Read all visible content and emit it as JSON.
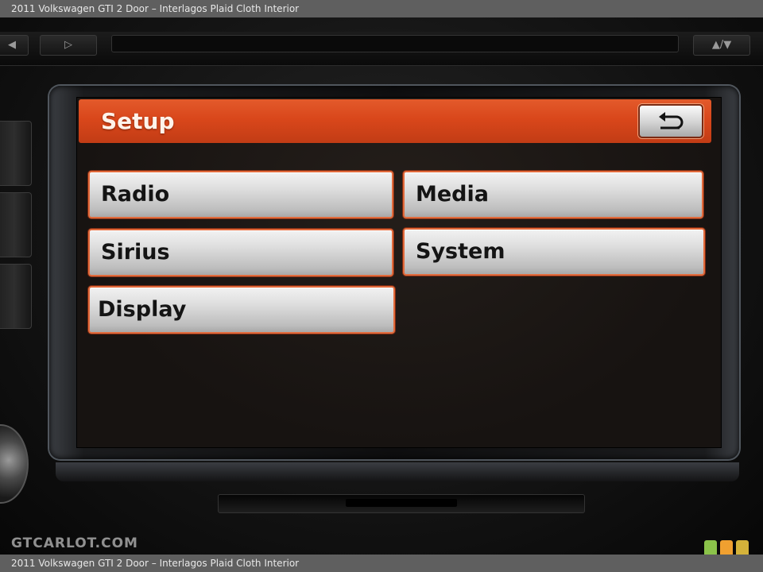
{
  "caption": {
    "top": "2011 Volkswagen GTI 2 Door – Interlagos Plaid Cloth Interior",
    "bottom": "2011 Volkswagen GTI 2 Door – Interlagos Plaid Cloth Interior"
  },
  "hardware": {
    "top_key_label": "▲/▼"
  },
  "screen": {
    "header": {
      "title": "Setup",
      "color": "#d9471b",
      "back_icon": "return-arrow-icon"
    },
    "menu": [
      {
        "label": "Radio"
      },
      {
        "label": "Media"
      },
      {
        "label": "Sirius"
      },
      {
        "label": "System"
      },
      {
        "label": "Display"
      }
    ]
  },
  "watermark": {
    "text": "GTCARLOT.COM",
    "badge_colors": [
      "#8bc34a",
      "#f0a030",
      "#d4b23a"
    ]
  }
}
